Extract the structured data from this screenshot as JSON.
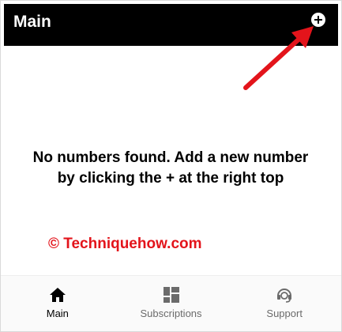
{
  "app_bar": {
    "title": "Main",
    "add_button_icon": "plus-circle-icon",
    "background": "#000000"
  },
  "main": {
    "empty_message": "No numbers found. Add a new number by clicking the + at the right top",
    "watermark": "© Techniquehow.com",
    "watermark_color": "#e3141b",
    "annotation_arrow_color": "#e3141b"
  },
  "bottom_nav": {
    "items": [
      {
        "label": "Main",
        "icon": "home-icon",
        "active": true
      },
      {
        "label": "Subscriptions",
        "icon": "dashboard-icon",
        "active": false
      },
      {
        "label": "Support",
        "icon": "headset-icon",
        "active": false
      }
    ]
  }
}
